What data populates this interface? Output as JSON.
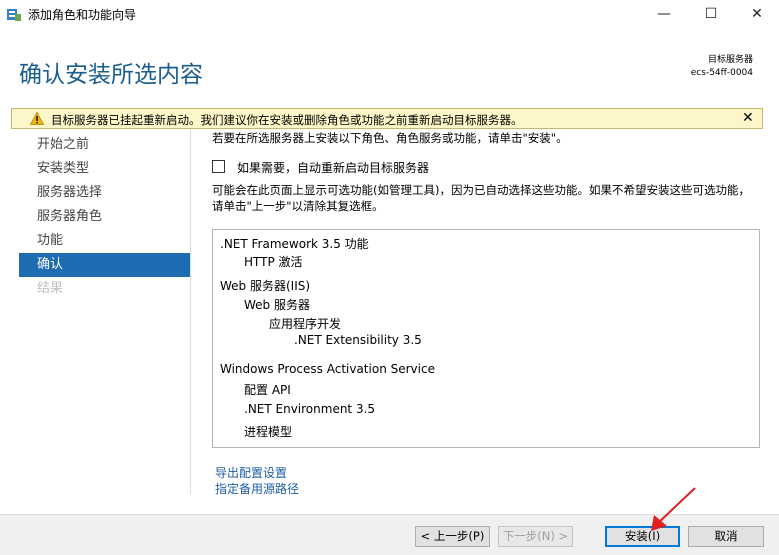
{
  "window": {
    "title": "添加角色和功能向导",
    "minimize_glyph": "—",
    "maximize_glyph": "☐",
    "close_glyph": "✕"
  },
  "header": {
    "heading": "确认安装所选内容",
    "server_label": "目标服务器",
    "server_name": "ecs-54ff-0004"
  },
  "warning": {
    "text": "目标服务器已挂起重新启动。我们建议你在安装或删除角色或功能之前重新启动目标服务器。",
    "close_glyph": "✕",
    "icon": "warning-icon"
  },
  "nav": {
    "items": [
      {
        "label": "开始之前"
      },
      {
        "label": "安装类型"
      },
      {
        "label": "服务器选择"
      },
      {
        "label": "服务器角色"
      },
      {
        "label": "功能"
      },
      {
        "label": "确认"
      },
      {
        "label": "结果"
      }
    ]
  },
  "main": {
    "intro": "若要在所选服务器上安装以下角色、角色服务或功能，请单击\"安装\"。",
    "restart_checkbox_label": "如果需要，自动重新启动目标服务器",
    "restart_checked": false,
    "note": "可能会在此页面上显示可选功能(如管理工具)，因为已自动选择这些功能。如果不希望安装这些可选功能，请单击\"上一步\"以清除其复选框。",
    "features": [
      ".NET Framework 3.5 功能",
      "HTTP 激活",
      "Web 服务器(IIS)",
      "Web 服务器",
      "应用程序开发",
      ".NET Extensibility 3.5",
      "Windows Process Activation Service",
      "配置 API",
      ".NET Environment 3.5",
      "进程模型"
    ],
    "links": {
      "export": "导出配置设置",
      "alt_source": "指定备用源路径"
    }
  },
  "footer": {
    "prev": "< 上一步(P)",
    "next": "下一步(N) >",
    "install": "安装(I)",
    "cancel": "取消"
  },
  "colors": {
    "accent": "#1d6bb0",
    "heading": "#1a5e8f",
    "warning_bg": "#fcf6c8",
    "link": "#1c5ea8",
    "annotation_arrow": "#e02020"
  }
}
